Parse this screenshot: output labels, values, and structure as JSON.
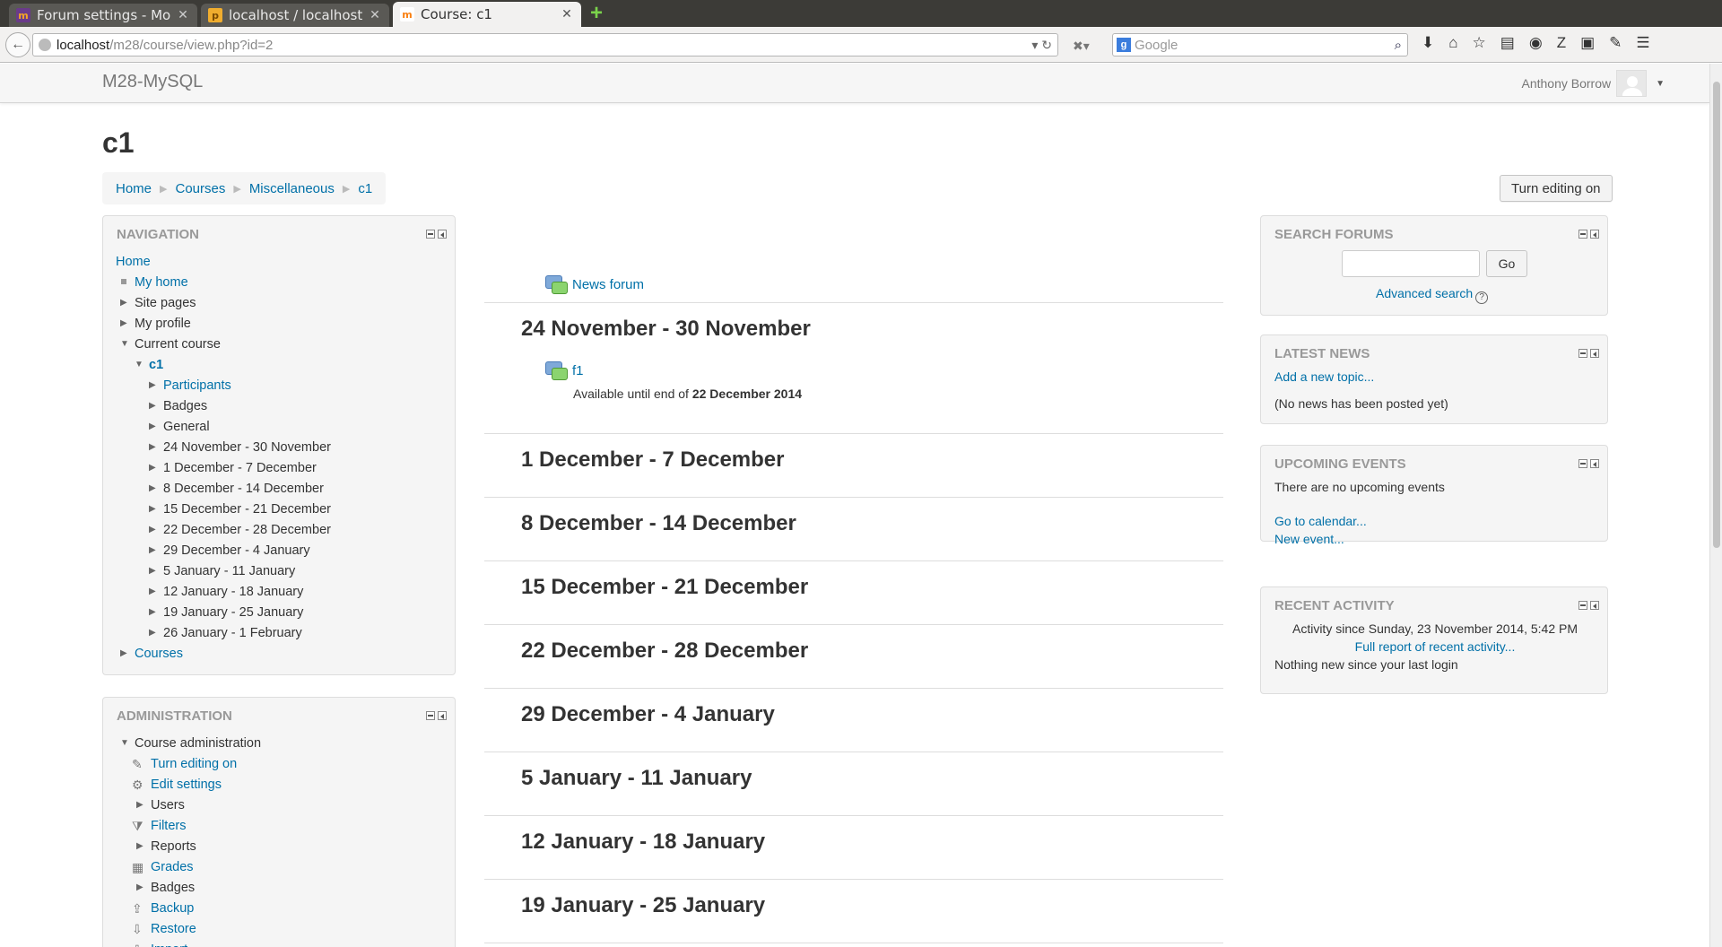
{
  "browser": {
    "tabs": [
      {
        "title": "Forum settings - Moo…",
        "favicon": "moodle-icon",
        "active": false
      },
      {
        "title": "localhost / localhost / …",
        "favicon": "phpmyadmin-icon",
        "active": false
      },
      {
        "title": "Course: c1",
        "favicon": "moodle-icon",
        "active": true
      }
    ],
    "url_host": "localhost",
    "url_path": "/m28/course/view.php?id=2",
    "search_placeholder": "Google"
  },
  "site": {
    "name": "M28-MySQL",
    "user": "Anthony Borrow"
  },
  "page": {
    "title": "c1",
    "breadcrumb": [
      "Home",
      "Courses",
      "Miscellaneous",
      "c1"
    ],
    "edit_button": "Turn editing on"
  },
  "navigation": {
    "title": "NAVIGATION",
    "items": [
      {
        "label": "Home",
        "link": true
      },
      {
        "label": "My home",
        "link": true,
        "bullet": true
      },
      {
        "label": "Site pages",
        "link": false,
        "arrow": "right"
      },
      {
        "label": "My profile",
        "link": false,
        "arrow": "right"
      },
      {
        "label": "Current course",
        "link": false,
        "arrow": "down"
      },
      {
        "label": "c1",
        "link": true,
        "arrow": "down",
        "bold": true
      },
      {
        "label": "Participants",
        "link": true,
        "arrow": "right"
      },
      {
        "label": "Badges",
        "link": false,
        "arrow": "right"
      },
      {
        "label": "General",
        "link": false,
        "arrow": "right"
      },
      {
        "label": "24 November - 30 November",
        "link": false,
        "arrow": "right"
      },
      {
        "label": "1 December - 7 December",
        "link": false,
        "arrow": "right"
      },
      {
        "label": "8 December - 14 December",
        "link": false,
        "arrow": "right"
      },
      {
        "label": "15 December - 21 December",
        "link": false,
        "arrow": "right"
      },
      {
        "label": "22 December - 28 December",
        "link": false,
        "arrow": "right"
      },
      {
        "label": "29 December - 4 January",
        "link": false,
        "arrow": "right"
      },
      {
        "label": "5 January - 11 January",
        "link": false,
        "arrow": "right"
      },
      {
        "label": "12 January - 18 January",
        "link": false,
        "arrow": "right"
      },
      {
        "label": "19 January - 25 January",
        "link": false,
        "arrow": "right"
      },
      {
        "label": "26 January - 1 February",
        "link": false,
        "arrow": "right"
      },
      {
        "label": "Courses",
        "link": true,
        "arrow": "right"
      }
    ]
  },
  "administration": {
    "title": "ADMINISTRATION",
    "items": [
      {
        "label": "Course administration",
        "link": false,
        "arrow": "down"
      },
      {
        "label": "Turn editing on",
        "link": true,
        "icon": "pencil-icon"
      },
      {
        "label": "Edit settings",
        "link": true,
        "icon": "gear-icon"
      },
      {
        "label": "Users",
        "link": false,
        "arrow": "right"
      },
      {
        "label": "Filters",
        "link": true,
        "icon": "filter-icon"
      },
      {
        "label": "Reports",
        "link": false,
        "arrow": "right"
      },
      {
        "label": "Grades",
        "link": true,
        "icon": "grades-icon"
      },
      {
        "label": "Badges",
        "link": false,
        "arrow": "right"
      },
      {
        "label": "Backup",
        "link": true,
        "icon": "backup-icon"
      },
      {
        "label": "Restore",
        "link": true,
        "icon": "restore-icon"
      },
      {
        "label": "Import",
        "link": true,
        "icon": "import-icon"
      }
    ]
  },
  "course": {
    "news_forum": "News forum",
    "sections": [
      "24 November - 30 November",
      "1 December - 7 December",
      "8 December - 14 December",
      "15 December - 21 December",
      "22 December - 28 December",
      "29 December - 4 January",
      "5 January - 11 January",
      "12 January - 18 January",
      "19 January - 25 January"
    ],
    "activity": "f1",
    "availability_prefix": "Available until end of ",
    "availability_date": "22 December 2014"
  },
  "search_forums": {
    "title": "SEARCH FORUMS",
    "go": "Go",
    "advanced": "Advanced search"
  },
  "latest_news": {
    "title": "LATEST NEWS",
    "add": "Add a new topic...",
    "empty": "(No news has been posted yet)"
  },
  "upcoming_events": {
    "title": "UPCOMING EVENTS",
    "empty": "There are no upcoming events",
    "calendar": "Go to calendar...",
    "new_event": "New event..."
  },
  "recent_activity": {
    "title": "RECENT ACTIVITY",
    "since": "Activity since Sunday, 23 November 2014, 5:42 PM",
    "full_report": "Full report of recent activity...",
    "nothing": "Nothing new since your last login"
  }
}
